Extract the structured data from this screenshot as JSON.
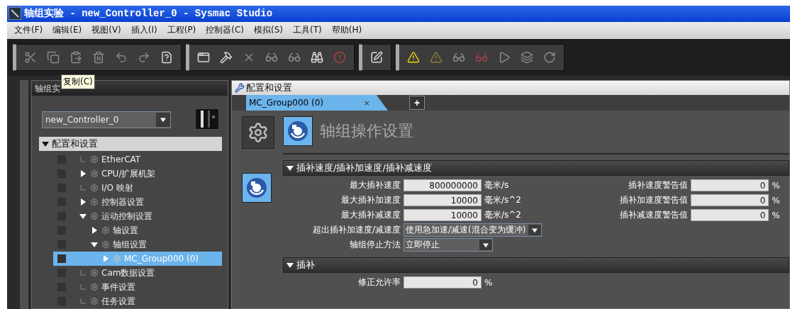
{
  "window": {
    "title": "轴组实验 - new_Controller_0 - Sysmac Studio"
  },
  "menu": [
    "文件(F)",
    "编辑(E)",
    "视图(V)",
    "插入(I)",
    "工程(P)",
    "控制器(C)",
    "模拟(S)",
    "工具(T)",
    "帮助(H)"
  ],
  "tooltip": "复制(C)",
  "sidebar": {
    "title": "轴组实",
    "controller": "new_Controller_0",
    "tree": {
      "label": "配置和设置",
      "expanded": true,
      "children": [
        {
          "label": "EtherCAT",
          "kind": "leaf",
          "expanded": false,
          "selected": false
        },
        {
          "label": "CPU/扩展机架",
          "kind": "branch",
          "expanded": false,
          "selected": false
        },
        {
          "label": "I/O 映射",
          "kind": "leaf",
          "expanded": false,
          "selected": false
        },
        {
          "label": "控制器设置",
          "kind": "branch",
          "expanded": false,
          "selected": false
        },
        {
          "label": "运动控制设置",
          "kind": "branch",
          "expanded": true,
          "selected": false,
          "children": [
            {
              "label": "轴设置",
              "kind": "branch",
              "expanded": false,
              "selected": false
            },
            {
              "label": "轴组设置",
              "kind": "branch",
              "expanded": true,
              "selected": false,
              "children": [
                {
                  "label": "MC_Group000 (0)",
                  "kind": "branch",
                  "expanded": false,
                  "selected": true
                }
              ]
            }
          ]
        },
        {
          "label": "Cam数据设置",
          "kind": "leaf",
          "expanded": false,
          "selected": false
        },
        {
          "label": "事件设置",
          "kind": "leaf",
          "expanded": false,
          "selected": false
        },
        {
          "label": "任务设置",
          "kind": "leaf",
          "expanded": false,
          "selected": false
        }
      ]
    }
  },
  "editor": {
    "title": "配置和设置",
    "tabs": [
      {
        "label": "MC_Group000 (0)",
        "selected": true,
        "close": "×"
      }
    ],
    "add_tab": "+",
    "page_title": "轴组操作设置",
    "sections": [
      {
        "title": "插补速度/插补加速度/插补减速度",
        "expanded": true,
        "fields": [
          {
            "kind": "number",
            "label": "最大插补速度",
            "value": "800000000",
            "unit": "毫米/s"
          },
          {
            "kind": "number",
            "label": "最大插补加速度",
            "value": "10000",
            "unit": "毫米/s^2"
          },
          {
            "kind": "number",
            "label": "最大插补减速度",
            "value": "10000",
            "unit": "毫米/s^2"
          },
          {
            "kind": "select",
            "label": "超出插补加速度/减速度",
            "value": "使用急加速/减速(混合变为缓冲)"
          },
          {
            "kind": "select",
            "label": "轴组停止方法",
            "value": "立即停止"
          }
        ],
        "side_fields": [
          {
            "label": "插补速度警告值",
            "value": "0",
            "unit": "%"
          },
          {
            "label": "插补加速度警告值",
            "value": "0",
            "unit": "%"
          },
          {
            "label": "插补减速度警告值",
            "value": "0",
            "unit": "%"
          }
        ]
      },
      {
        "title": "插补",
        "expanded": true,
        "fields": [
          {
            "kind": "number",
            "label": "修正允许率",
            "value": "0",
            "unit": "%"
          }
        ]
      }
    ]
  }
}
